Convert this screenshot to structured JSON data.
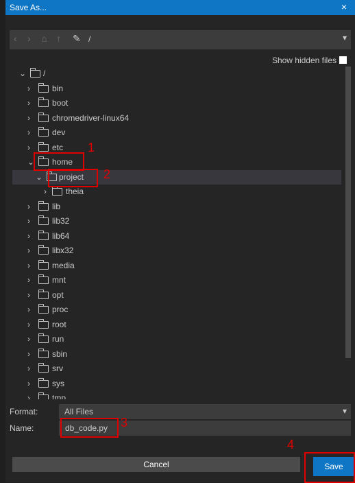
{
  "dialog": {
    "title": "Save As...",
    "close_glyph": "×"
  },
  "toolbar": {
    "icons": [
      "back-icon",
      "forward-icon",
      "home-icon",
      "up-icon",
      "edit-path-icon"
    ],
    "path": "/"
  },
  "options": {
    "show_hidden_label": "Show hidden files",
    "show_hidden_checked": false
  },
  "tree": {
    "root": "/",
    "items": [
      {
        "label": "bin"
      },
      {
        "label": "boot"
      },
      {
        "label": "chromedriver-linux64"
      },
      {
        "label": "dev"
      },
      {
        "label": "etc"
      },
      {
        "label": "home"
      },
      {
        "label": "project"
      },
      {
        "label": "theia"
      },
      {
        "label": "lib"
      },
      {
        "label": "lib32"
      },
      {
        "label": "lib64"
      },
      {
        "label": "libx32"
      },
      {
        "label": "media"
      },
      {
        "label": "mnt"
      },
      {
        "label": "opt"
      },
      {
        "label": "proc"
      },
      {
        "label": "root"
      },
      {
        "label": "run"
      },
      {
        "label": "sbin"
      },
      {
        "label": "srv"
      },
      {
        "label": "sys"
      },
      {
        "label": "tmp"
      }
    ]
  },
  "form": {
    "format_label": "Format:",
    "format_value": "All Files",
    "name_label": "Name:",
    "name_value": "db_code.py"
  },
  "buttons": {
    "cancel": "Cancel",
    "save": "Save"
  },
  "annotations": [
    "1",
    "2",
    "3",
    "4"
  ],
  "colors": {
    "accent": "#0e76c4",
    "annotation": "#e00000"
  }
}
